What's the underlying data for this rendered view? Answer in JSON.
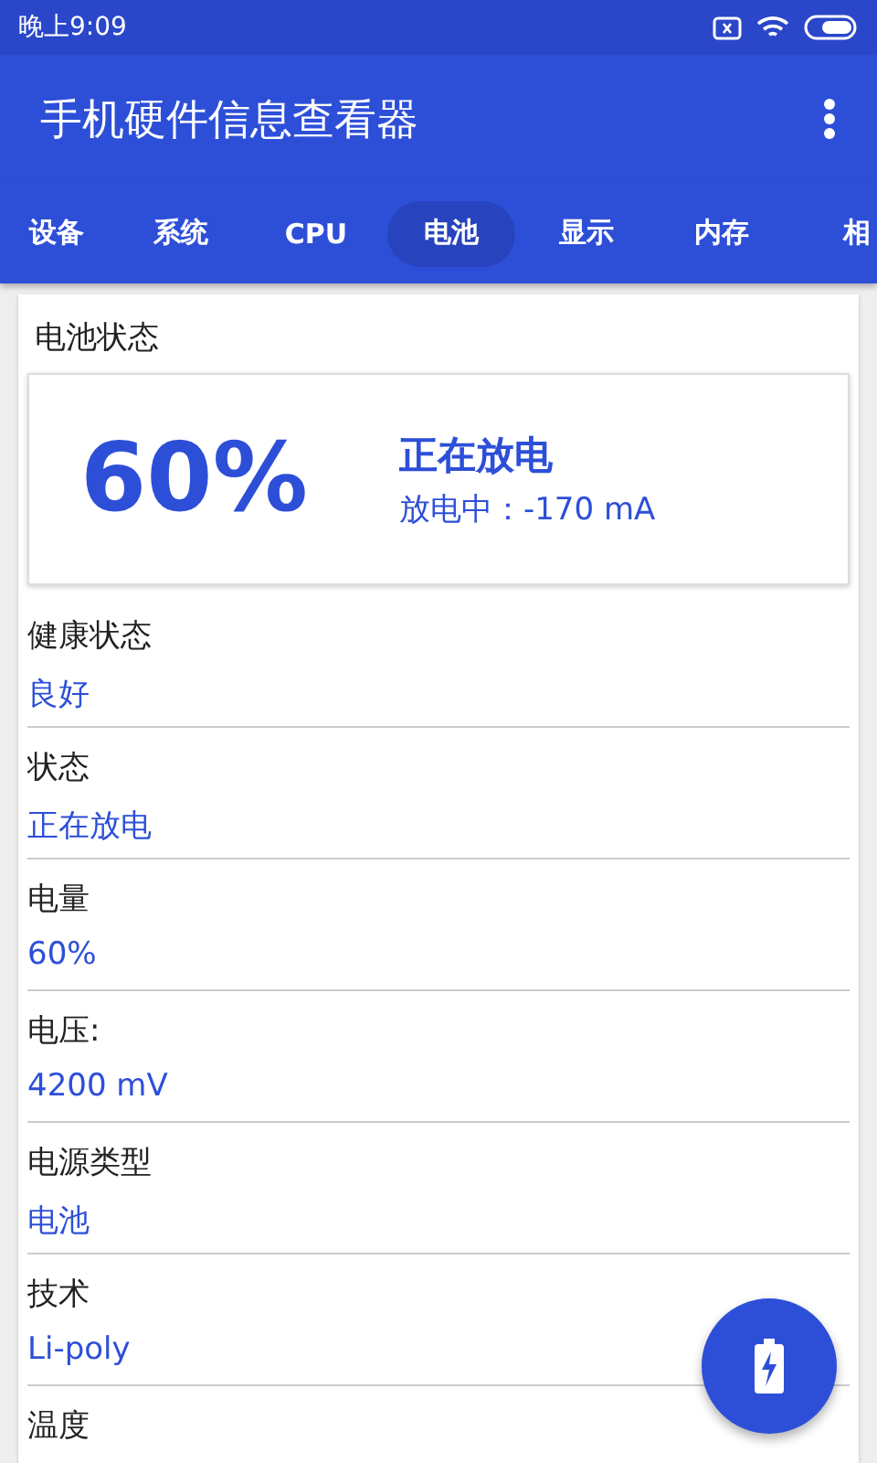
{
  "status_bar": {
    "time": "晚上9:09"
  },
  "app_bar": {
    "title": "手机硬件信息查看器"
  },
  "tabs": [
    {
      "label": "设备",
      "selected": false
    },
    {
      "label": "系统",
      "selected": false
    },
    {
      "label": "CPU",
      "selected": false
    },
    {
      "label": "电池",
      "selected": true
    },
    {
      "label": "显示",
      "selected": false
    },
    {
      "label": "内存",
      "selected": false
    },
    {
      "label": "相",
      "selected": false
    }
  ],
  "battery_card": {
    "title": "电池状态",
    "percent": "60%",
    "status": "正在放电",
    "detail": "放电中：-170 mA"
  },
  "items": [
    {
      "label": "健康状态",
      "value": "良好"
    },
    {
      "label": "状态",
      "value": "正在放电"
    },
    {
      "label": "电量",
      "value": "60%"
    },
    {
      "label": "电压:",
      "value": "4200 mV"
    },
    {
      "label": "电源类型",
      "value": "电池"
    },
    {
      "label": "技术",
      "value": "Li-poly"
    },
    {
      "label": "温度"
    }
  ]
}
